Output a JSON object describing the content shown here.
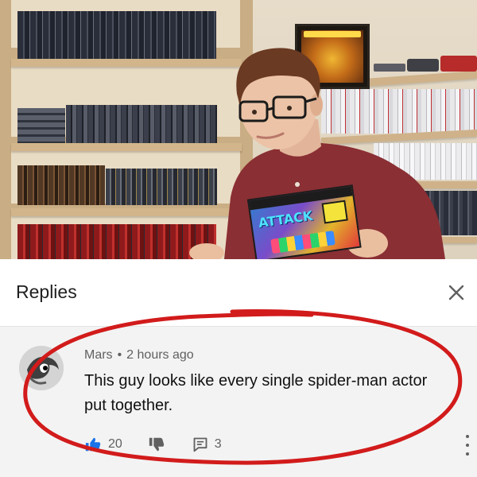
{
  "replies": {
    "title": "Replies"
  },
  "comment": {
    "author": "Mars",
    "separator": "•",
    "time": "2 hours ago",
    "text": "This guy looks like every single spider-man actor put together.",
    "likes": "20",
    "reply_count": "3"
  },
  "box_art": {
    "title": "ATTACK"
  },
  "icons": {
    "close": "close-icon",
    "like": "thumbs-up-icon",
    "dislike": "thumbs-down-icon",
    "reply": "comment-icon",
    "more": "more-vertical-icon"
  },
  "colors": {
    "like_blue": "#1a73e8",
    "annotation_red": "#d21b1b",
    "secondary_text": "#606060"
  }
}
